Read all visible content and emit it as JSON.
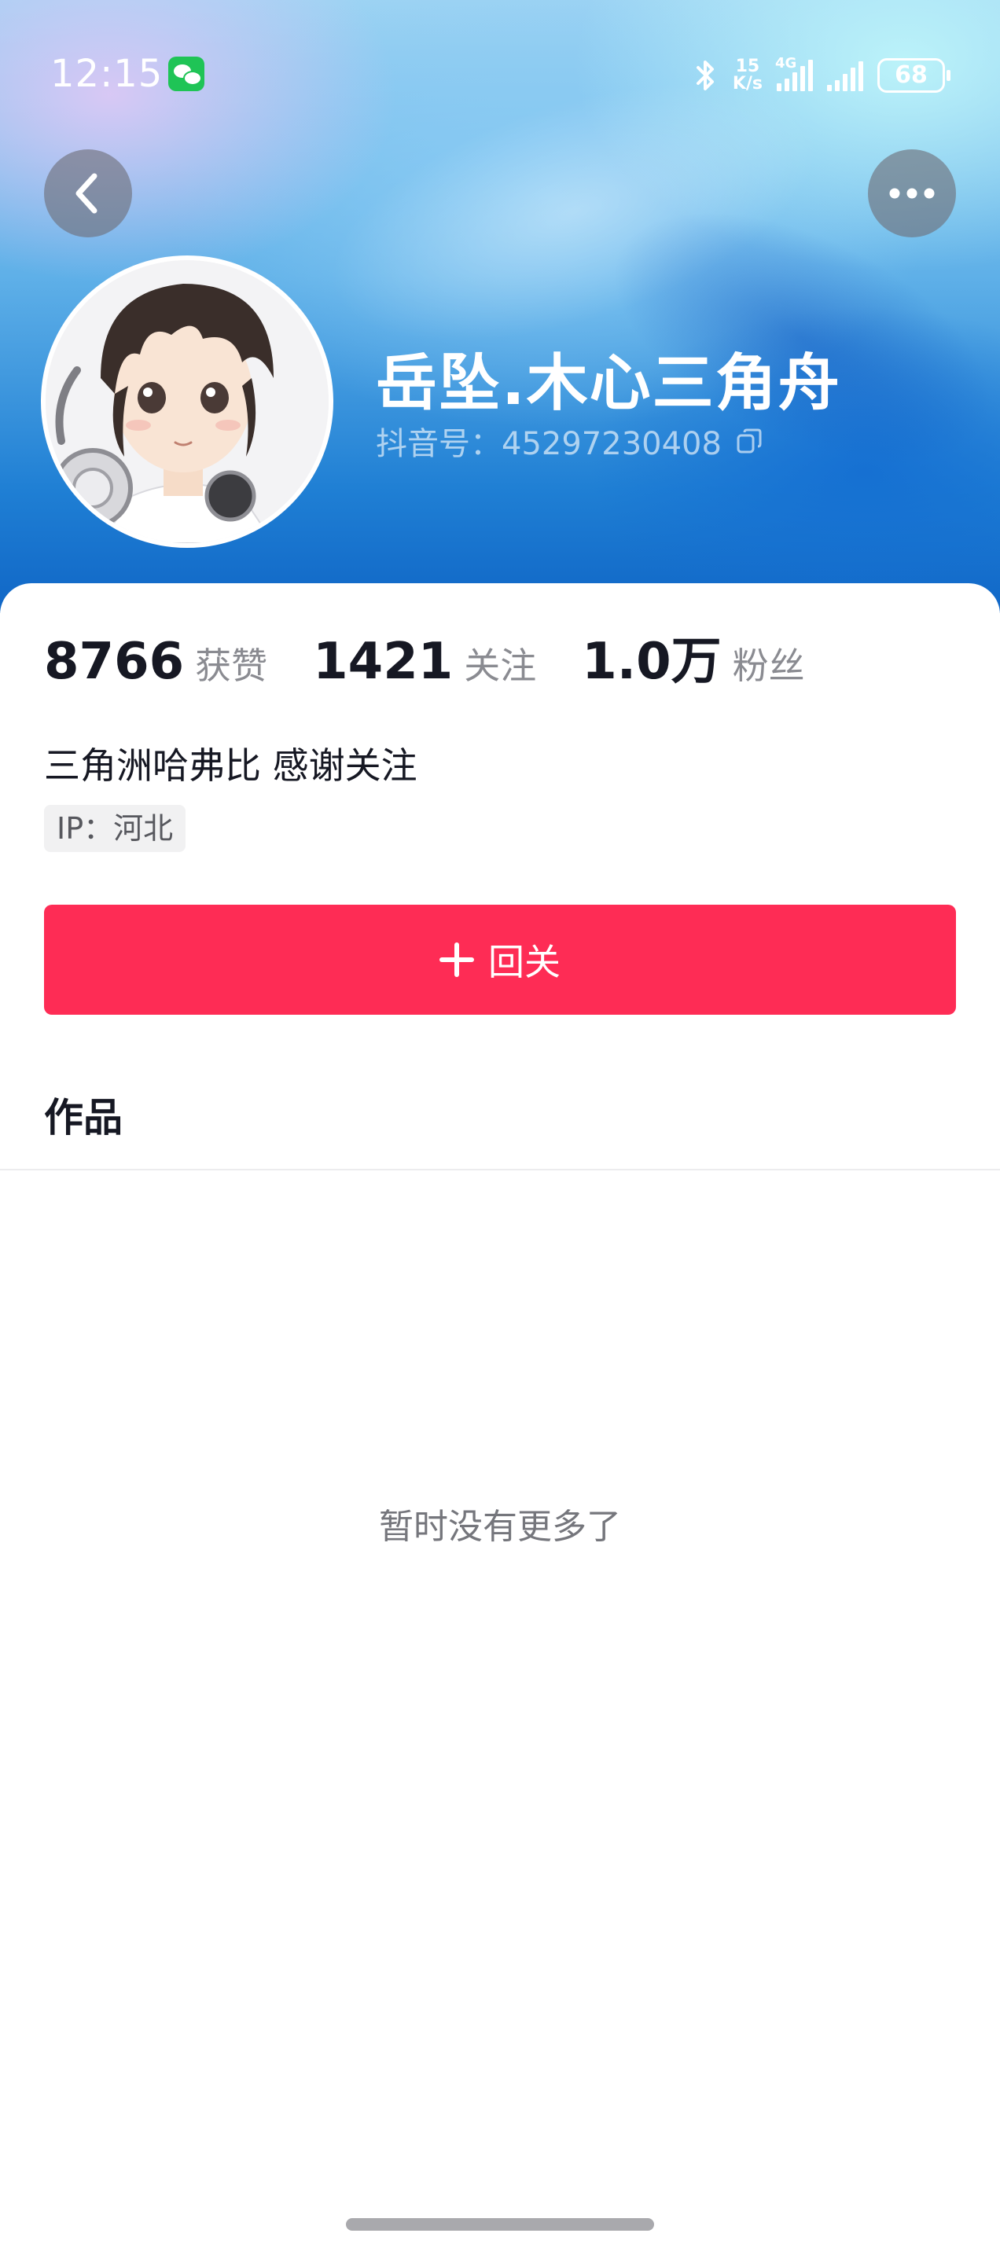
{
  "status_bar": {
    "time": "12:15",
    "app_icon": "wechat-icon",
    "bluetooth_icon": "bluetooth-icon",
    "network_speed_value": "15",
    "network_speed_unit": "K/s",
    "network_type": "4G",
    "battery": "68"
  },
  "header": {
    "back_icon": "chevron-left-icon",
    "more_icon": "more-dots-icon",
    "username": "岳坠.木心三角舟",
    "douyin_id": "抖音号：45297230408",
    "copy_icon": "copy-icon"
  },
  "stats": [
    {
      "value": "8766",
      "label": "获赞"
    },
    {
      "value": "1421",
      "label": "关注"
    },
    {
      "value": "1.0万",
      "label": "粉丝"
    }
  ],
  "bio": "三角洲哈弗比 感谢关注",
  "ip": "IP：河北",
  "follow_button": {
    "label": "回关",
    "color": "#fe2c55"
  },
  "tabs": {
    "works": "作品"
  },
  "empty_state": "暂时没有更多了"
}
